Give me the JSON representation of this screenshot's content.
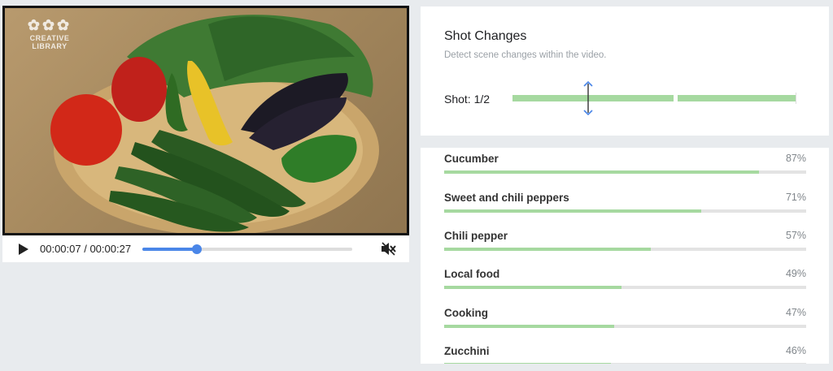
{
  "video": {
    "watermark": [
      "CREATIVE",
      "LIBRARY"
    ],
    "time": "00:00:07 / 00:00:27",
    "progress": 0.26,
    "icons": {
      "play": "play-icon",
      "mute": "volume-muted-icon"
    }
  },
  "shots": {
    "title": "Shot Changes",
    "subtitle": "Detect scene changes within the video.",
    "label": "Shot: 1/2"
  },
  "labels": [
    {
      "name": "Cucumber",
      "percent": "87%",
      "value": 0.87
    },
    {
      "name": "Sweet and chili peppers",
      "percent": "71%",
      "value": 0.71
    },
    {
      "name": "Chili pepper",
      "percent": "57%",
      "value": 0.57
    },
    {
      "name": "Local food",
      "percent": "49%",
      "value": 0.49
    },
    {
      "name": "Cooking",
      "percent": "47%",
      "value": 0.47
    },
    {
      "name": "Zucchini",
      "percent": "46%",
      "value": 0.46
    }
  ],
  "colors": {
    "accent": "#4a86e8",
    "bar": "#a6d9a0",
    "track": "#e3e3e3"
  }
}
